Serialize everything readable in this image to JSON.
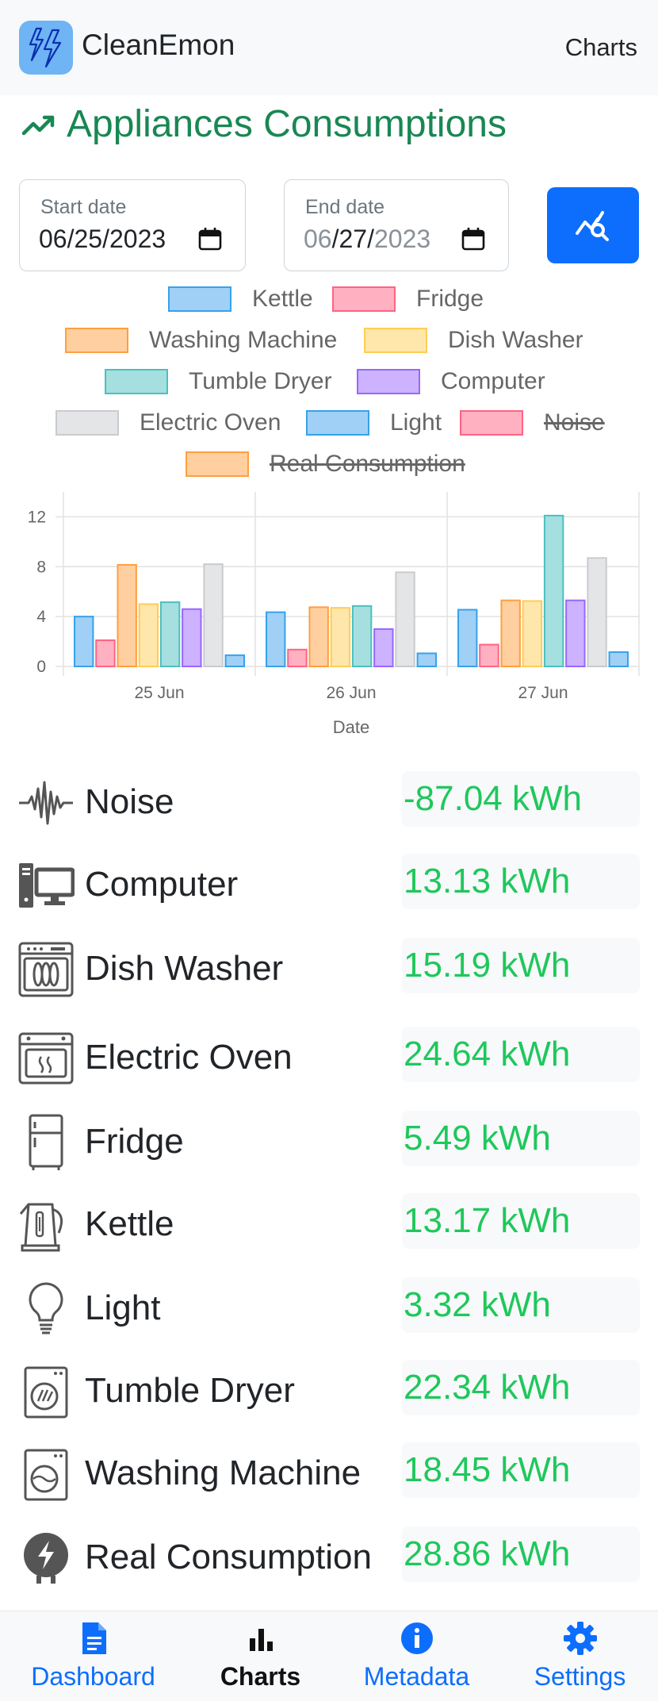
{
  "header": {
    "brand": "CleanEmon",
    "page": "Charts"
  },
  "title": "Appliances Consumptions",
  "dates": {
    "start_label": "Start date",
    "start_value": "06/25/2023",
    "end_label": "End date",
    "end_value_mm": "06",
    "end_value_dd": "/27/",
    "end_value_yyyy": "2023"
  },
  "legend": [
    {
      "label": "Kettle",
      "fill": "#a0d0f5",
      "stroke": "#36a2eb",
      "hidden": false
    },
    {
      "label": "Fridge",
      "fill": "#ffb1c1",
      "stroke": "#ff6384",
      "hidden": false
    },
    {
      "label": "Washing Machine",
      "fill": "#ffcf9f",
      "stroke": "#ff9f40",
      "hidden": false
    },
    {
      "label": "Dish Washer",
      "fill": "#ffe6aa",
      "stroke": "#ffcd56",
      "hidden": false
    },
    {
      "label": "Tumble Dryer",
      "fill": "#a5dfdf",
      "stroke": "#4bc0c0",
      "hidden": false
    },
    {
      "label": "Computer",
      "fill": "#ccb2ff",
      "stroke": "#9966ff",
      "hidden": false
    },
    {
      "label": "Electric Oven",
      "fill": "#e4e5e7",
      "stroke": "#c9cbcf",
      "hidden": false
    },
    {
      "label": "Light",
      "fill": "#a0d0f5",
      "stroke": "#36a2eb",
      "hidden": false
    },
    {
      "label": "Noise",
      "fill": "#ffb1c1",
      "stroke": "#ff6384",
      "hidden": true
    },
    {
      "label": "Real Consumption",
      "fill": "#ffcf9f",
      "stroke": "#ff9f40",
      "hidden": true
    }
  ],
  "chart_data": {
    "type": "bar",
    "categories": [
      "25 Jun",
      "26 Jun",
      "27 Jun"
    ],
    "xlabel": "Date",
    "ylabel": "",
    "ylim": [
      0,
      14
    ],
    "yticks": [
      "0",
      "4",
      "8",
      "12"
    ],
    "grid": true,
    "series": [
      {
        "name": "Kettle",
        "values": [
          4.0,
          4.35,
          4.55
        ]
      },
      {
        "name": "Fridge",
        "values": [
          2.1,
          1.35,
          1.75
        ]
      },
      {
        "name": "Washing Machine",
        "values": [
          8.15,
          4.75,
          5.3
        ]
      },
      {
        "name": "Dish Washer",
        "values": [
          5.0,
          4.7,
          5.25
        ]
      },
      {
        "name": "Tumble Dryer",
        "values": [
          5.15,
          4.85,
          12.1
        ]
      },
      {
        "name": "Computer",
        "values": [
          4.6,
          3.0,
          5.3
        ]
      },
      {
        "name": "Electric Oven",
        "values": [
          8.2,
          7.55,
          8.7
        ]
      },
      {
        "name": "Light",
        "values": [
          0.9,
          1.05,
          1.15
        ]
      }
    ]
  },
  "appliances": [
    {
      "icon": "noise-icon",
      "name": "Noise",
      "value": "-87.04 kWh"
    },
    {
      "icon": "computer-icon",
      "name": "Computer",
      "value": "13.13 kWh"
    },
    {
      "icon": "dish-washer-icon",
      "name": "Dish Washer",
      "value": "15.19 kWh"
    },
    {
      "icon": "electric-oven-icon",
      "name": "Electric Oven",
      "value": "24.64 kWh"
    },
    {
      "icon": "fridge-icon",
      "name": "Fridge",
      "value": "5.49 kWh"
    },
    {
      "icon": "kettle-icon",
      "name": "Kettle",
      "value": "13.17 kWh"
    },
    {
      "icon": "light-bulb-icon",
      "name": "Light",
      "value": "3.32 kWh"
    },
    {
      "icon": "tumble-dryer-icon",
      "name": "Tumble Dryer",
      "value": "22.34 kWh"
    },
    {
      "icon": "washing-machine-icon",
      "name": "Washing Machine",
      "value": "18.45 kWh"
    },
    {
      "icon": "real-consumption-icon",
      "name": "Real Consumption",
      "value": "28.86 kWh"
    }
  ],
  "bottom_nav": [
    {
      "label": "Dashboard",
      "icon": "document-icon",
      "active": false
    },
    {
      "label": "Charts",
      "icon": "bar-chart-icon",
      "active": true
    },
    {
      "label": "Metadata",
      "icon": "info-icon",
      "active": false
    },
    {
      "label": "Settings",
      "icon": "gear-icon",
      "active": false
    }
  ],
  "colors": {
    "accent": "#0d6efd",
    "title": "#198754",
    "value": "#1ec85c"
  }
}
